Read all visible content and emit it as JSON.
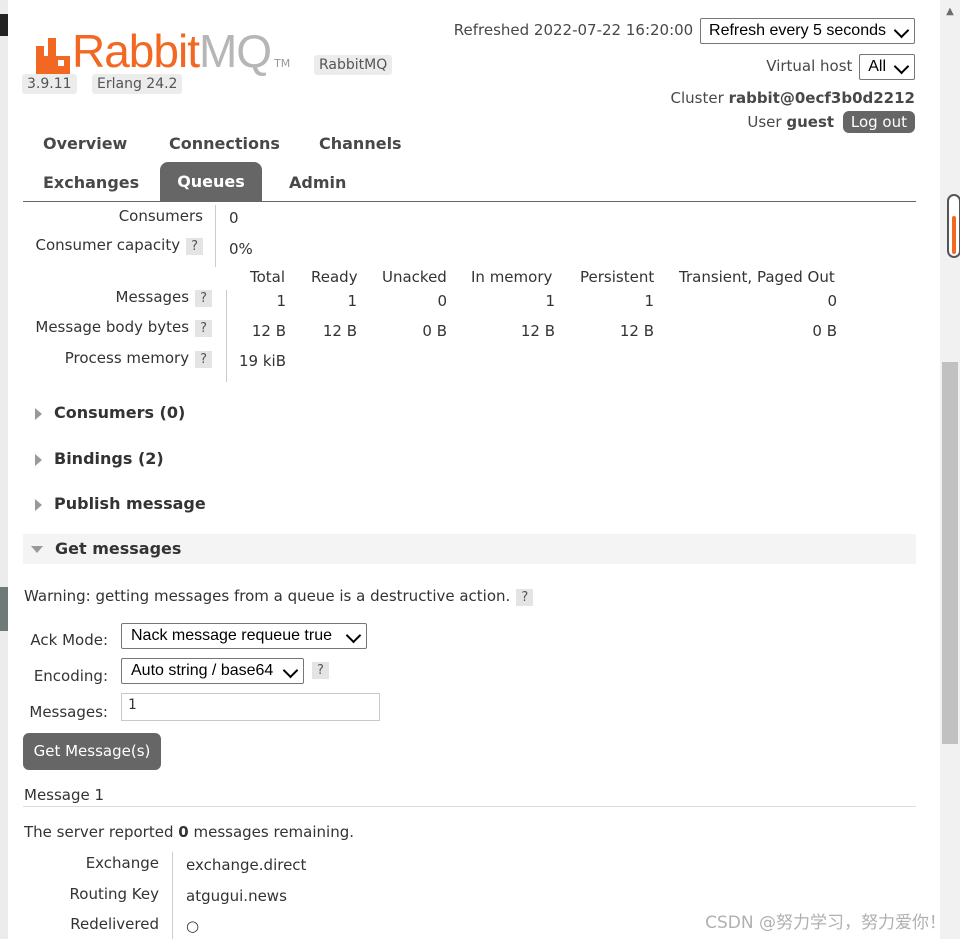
{
  "app": {
    "logo_rabbit": "Rabbit",
    "logo_mq": "MQ",
    "tm": "TM",
    "product_tag": "RabbitMQ",
    "version": "3.9.11",
    "erlang": "Erlang 24.2",
    "brand_color": "#f26822"
  },
  "header": {
    "refreshed": "Refreshed 2022-07-22 16:20:00",
    "refresh_select": "Refresh every 5 seconds",
    "vhost_label": "Virtual host",
    "vhost_select": "All",
    "cluster_label": "Cluster",
    "cluster_name": "rabbit@0ecf3b0d2212",
    "user_label": "User",
    "user_name": "guest",
    "logout": "Log out"
  },
  "nav": {
    "overview": "Overview",
    "connections": "Connections",
    "channels": "Channels",
    "exchanges": "Exchanges",
    "queues": "Queues",
    "admin": "Admin",
    "selected": "Queues"
  },
  "details": {
    "consumers_label": "Consumers",
    "consumers_value": "0",
    "capacity_label": "Consumer capacity",
    "capacity_value": "0%",
    "help": "?"
  },
  "stats": {
    "columns": [
      "Total",
      "Ready",
      "Unacked",
      "In memory",
      "Persistent",
      "Transient, Paged Out"
    ],
    "rows": [
      {
        "label": "Messages",
        "values": [
          "1",
          "1",
          "0",
          "1",
          "1",
          "0"
        ]
      },
      {
        "label": "Message body bytes",
        "values": [
          "12 B",
          "12 B",
          "0 B",
          "12 B",
          "12 B",
          "0 B"
        ]
      },
      {
        "label": "Process memory",
        "values": [
          "19 kiB"
        ]
      }
    ]
  },
  "sections": {
    "consumers": "Consumers (0)",
    "bindings": "Bindings (2)",
    "publish": "Publish message",
    "get": "Get messages"
  },
  "get_messages": {
    "warning": "Warning: getting messages from a queue is a destructive action.",
    "ack_label": "Ack Mode:",
    "ack_value": "Nack message requeue true",
    "encoding_label": "Encoding:",
    "encoding_value": "Auto string / base64",
    "messages_label": "Messages:",
    "messages_value": "1",
    "button": "Get Message(s)"
  },
  "message": {
    "title": "Message 1",
    "remaining_prefix": "The server reported",
    "remaining_count": "0",
    "remaining_suffix": "messages remaining.",
    "fields": [
      {
        "label": "Exchange",
        "value": "exchange.direct"
      },
      {
        "label": "Routing Key",
        "value": "atgugui.news"
      },
      {
        "label": "Redelivered",
        "value": "○"
      }
    ]
  },
  "watermark": "CSDN @努力学习，努力爱你！"
}
